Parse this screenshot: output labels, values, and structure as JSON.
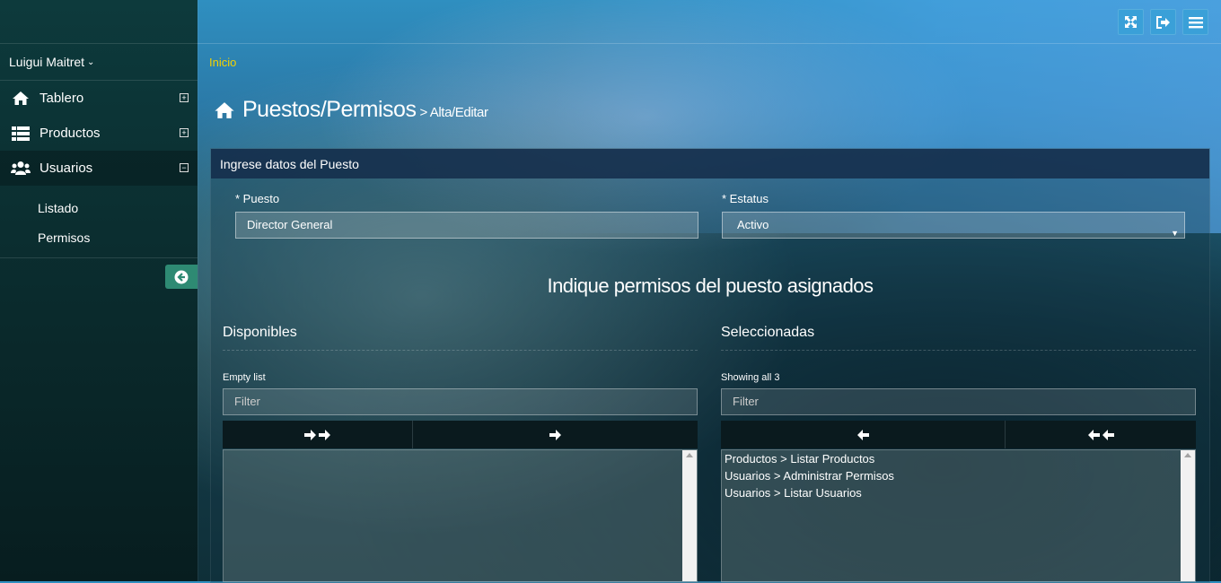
{
  "sidebar": {
    "user_name": "Luigui Maitret",
    "menu": [
      {
        "label": "Tablero",
        "icon": "home-icon",
        "expander": "plus"
      },
      {
        "label": "Productos",
        "icon": "list-icon",
        "expander": "plus"
      },
      {
        "label": "Usuarios",
        "icon": "users-icon",
        "expander": "minus"
      }
    ],
    "submenu": [
      "Listado",
      "Permisos"
    ]
  },
  "topbar": {
    "icons": [
      "fullscreen-icon",
      "logout-icon",
      "menu-icon"
    ]
  },
  "breadcrumb": {
    "home": "Inicio"
  },
  "page": {
    "title": "Puestos/Permisos",
    "subtitle": "> Alta/Editar"
  },
  "panel": {
    "header": "Ingrese datos del Puesto",
    "puesto_label": "* Puesto",
    "puesto_value": "Director General",
    "estatus_label": "* Estatus",
    "estatus_value": "Activo",
    "section_title": "Indique permisos del puesto asignados",
    "available": {
      "title": "Disponibles",
      "info": "Empty list",
      "filter_placeholder": "Filter",
      "items": []
    },
    "selected": {
      "title": "Seleccionadas",
      "info": "Showing all 3",
      "filter_placeholder": "Filter",
      "items": [
        "Productos > Listar Productos",
        "Usuarios > Administrar Permisos",
        "Usuarios > Listar Usuarios"
      ]
    }
  },
  "colors": {
    "accent_yellow": "#f4d200",
    "topbar_button": "#3aa0d8",
    "collapse_button": "#2e8a73"
  }
}
